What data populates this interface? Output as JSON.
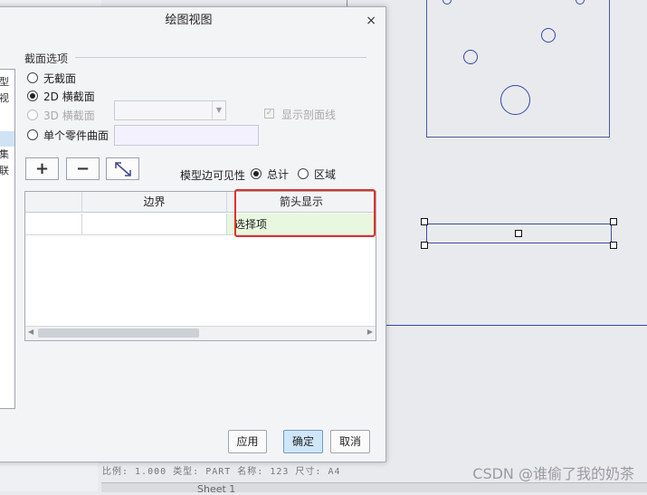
{
  "dialog": {
    "title": "绘图视图",
    "close_glyph": "×",
    "side_list_chars": [
      "型",
      "视",
      "",
      "",
      "",
      "集",
      "联"
    ],
    "section_group_label": "截面选项",
    "section_options": [
      {
        "label": "无截面",
        "selected": false,
        "disabled": false
      },
      {
        "label": "2D 横截面",
        "selected": true,
        "disabled": false
      },
      {
        "label": "3D 横截面",
        "selected": false,
        "disabled": true
      },
      {
        "label": "单个零件曲面",
        "selected": false,
        "disabled": false
      }
    ],
    "show_hatch_label": "显示剖面线",
    "show_hatch_checked": true,
    "tool_buttons": [
      "add-icon",
      "remove-icon",
      "edit-diagonal-icon"
    ],
    "model_edge_visibility_label": "模型边可见性",
    "visibility_options": [
      {
        "label": "总计",
        "selected": true
      },
      {
        "label": "区域",
        "selected": false
      }
    ],
    "table": {
      "columns": [
        "",
        "边界",
        "箭头显示"
      ],
      "rows": [
        [
          "",
          "",
          "选择项"
        ]
      ]
    },
    "buttons": {
      "apply": "应用",
      "ok": "确定",
      "cancel": "取消"
    }
  },
  "canvas": {
    "title_block": "比例: 1.000   类型: PART   名称: 123   尺寸: A4",
    "sheet_tab": "Sheet 1",
    "watermark": "CSDN @谁偷了我的奶茶"
  },
  "colors": {
    "highlight_border": "#e0302a",
    "selected_cell": "#e8f8df",
    "primary_button": "#cfe6f9",
    "drawing_line": "#2f49a8"
  }
}
